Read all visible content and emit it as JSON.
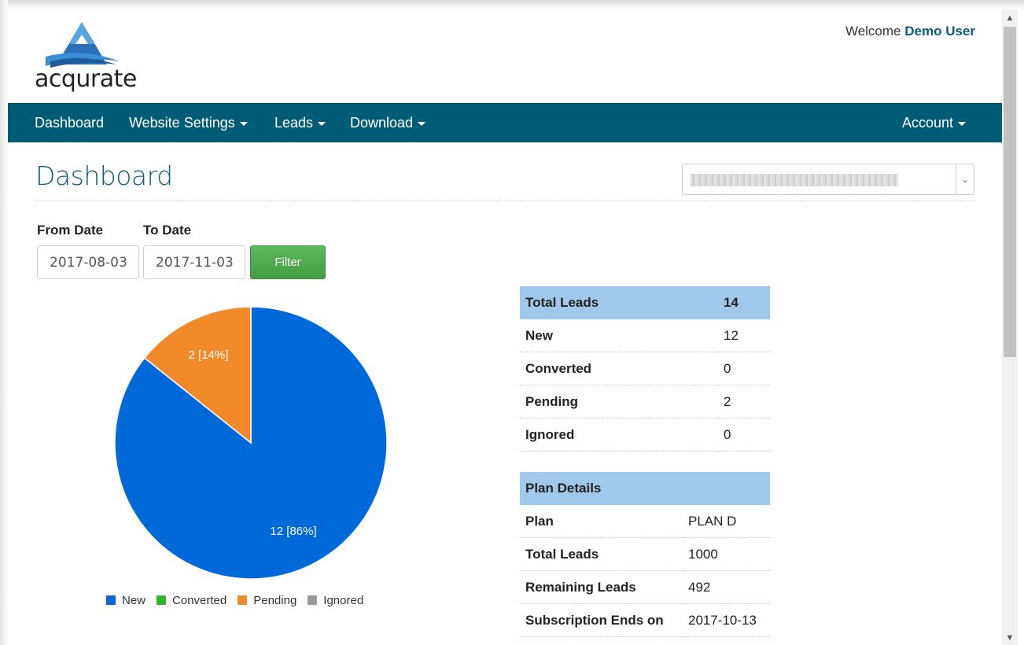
{
  "brand": {
    "name": "acqurate"
  },
  "header": {
    "welcome_prefix": "Welcome",
    "user_name": "Demo User"
  },
  "nav": {
    "left": [
      {
        "label": "Dashboard",
        "has_dropdown": false
      },
      {
        "label": "Website Settings",
        "has_dropdown": true
      },
      {
        "label": "Leads",
        "has_dropdown": true
      },
      {
        "label": "Download",
        "has_dropdown": true
      }
    ],
    "right": {
      "label": "Account",
      "has_dropdown": true
    }
  },
  "page": {
    "title": "Dashboard"
  },
  "filter": {
    "from_label": "From Date",
    "from_value": "2017-08-03",
    "to_label": "To Date",
    "to_value": "2017-11-03",
    "button_label": "Filter"
  },
  "chart_data": {
    "type": "pie",
    "slices": [
      {
        "name": "New",
        "value": 12,
        "label": "12 [86%]",
        "color": "#0069d9"
      },
      {
        "name": "Converted",
        "value": 0,
        "label": "",
        "color": "#2fb62f"
      },
      {
        "name": "Pending",
        "value": 2,
        "label": "2 [14%]",
        "color": "#f38a2a"
      },
      {
        "name": "Ignored",
        "value": 0,
        "label": "",
        "color": "#999999"
      }
    ],
    "legend_position": "bottom"
  },
  "leads_summary": {
    "header": {
      "label": "Total Leads",
      "value": "14"
    },
    "rows": [
      {
        "label": "New",
        "value": "12"
      },
      {
        "label": "Converted",
        "value": "0"
      },
      {
        "label": "Pending",
        "value": "2"
      },
      {
        "label": "Ignored",
        "value": "0"
      }
    ]
  },
  "plan_details": {
    "header": "Plan Details",
    "rows": [
      {
        "label": "Plan",
        "value": "PLAN D"
      },
      {
        "label": "Total Leads",
        "value": "1000"
      },
      {
        "label": "Remaining Leads",
        "value": "492"
      },
      {
        "label": "Subscription Ends on",
        "value": "2017-10-13"
      }
    ]
  },
  "colors": {
    "nav_bg": "#005b74",
    "accent": "#0e5b78",
    "table_header": "#9fc8ea",
    "filter_button": "#5cb85c"
  }
}
